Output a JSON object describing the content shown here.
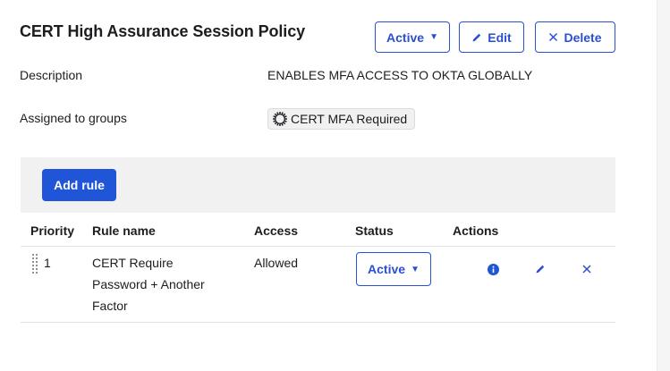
{
  "policy": {
    "title": "CERT High Assurance Session Policy",
    "status_button": "Active",
    "edit_label": "Edit",
    "delete_label": "Delete",
    "description_label": "Description",
    "description_value": "ENABLES MFA ACCESS TO OKTA GLOBALLY",
    "groups_label": "Assigned to groups",
    "group_name": "CERT MFA Required"
  },
  "rules": {
    "add_rule_label": "Add rule",
    "columns": [
      "Priority",
      "Rule name",
      "Access",
      "Status",
      "Actions"
    ],
    "rows": [
      {
        "priority": "1",
        "name_lines": [
          "CERT Require",
          "Password + Another",
          "Factor"
        ],
        "access": "Allowed",
        "status": "Active"
      }
    ]
  },
  "colors": {
    "primary": "#1f55d6",
    "outline": "#2b4fd1",
    "panel_bg": "#f1f1f2"
  },
  "icons": [
    "caret-down-icon",
    "pencil-icon",
    "close-icon",
    "group-gear-icon",
    "drag-handle-icon",
    "info-icon"
  ]
}
